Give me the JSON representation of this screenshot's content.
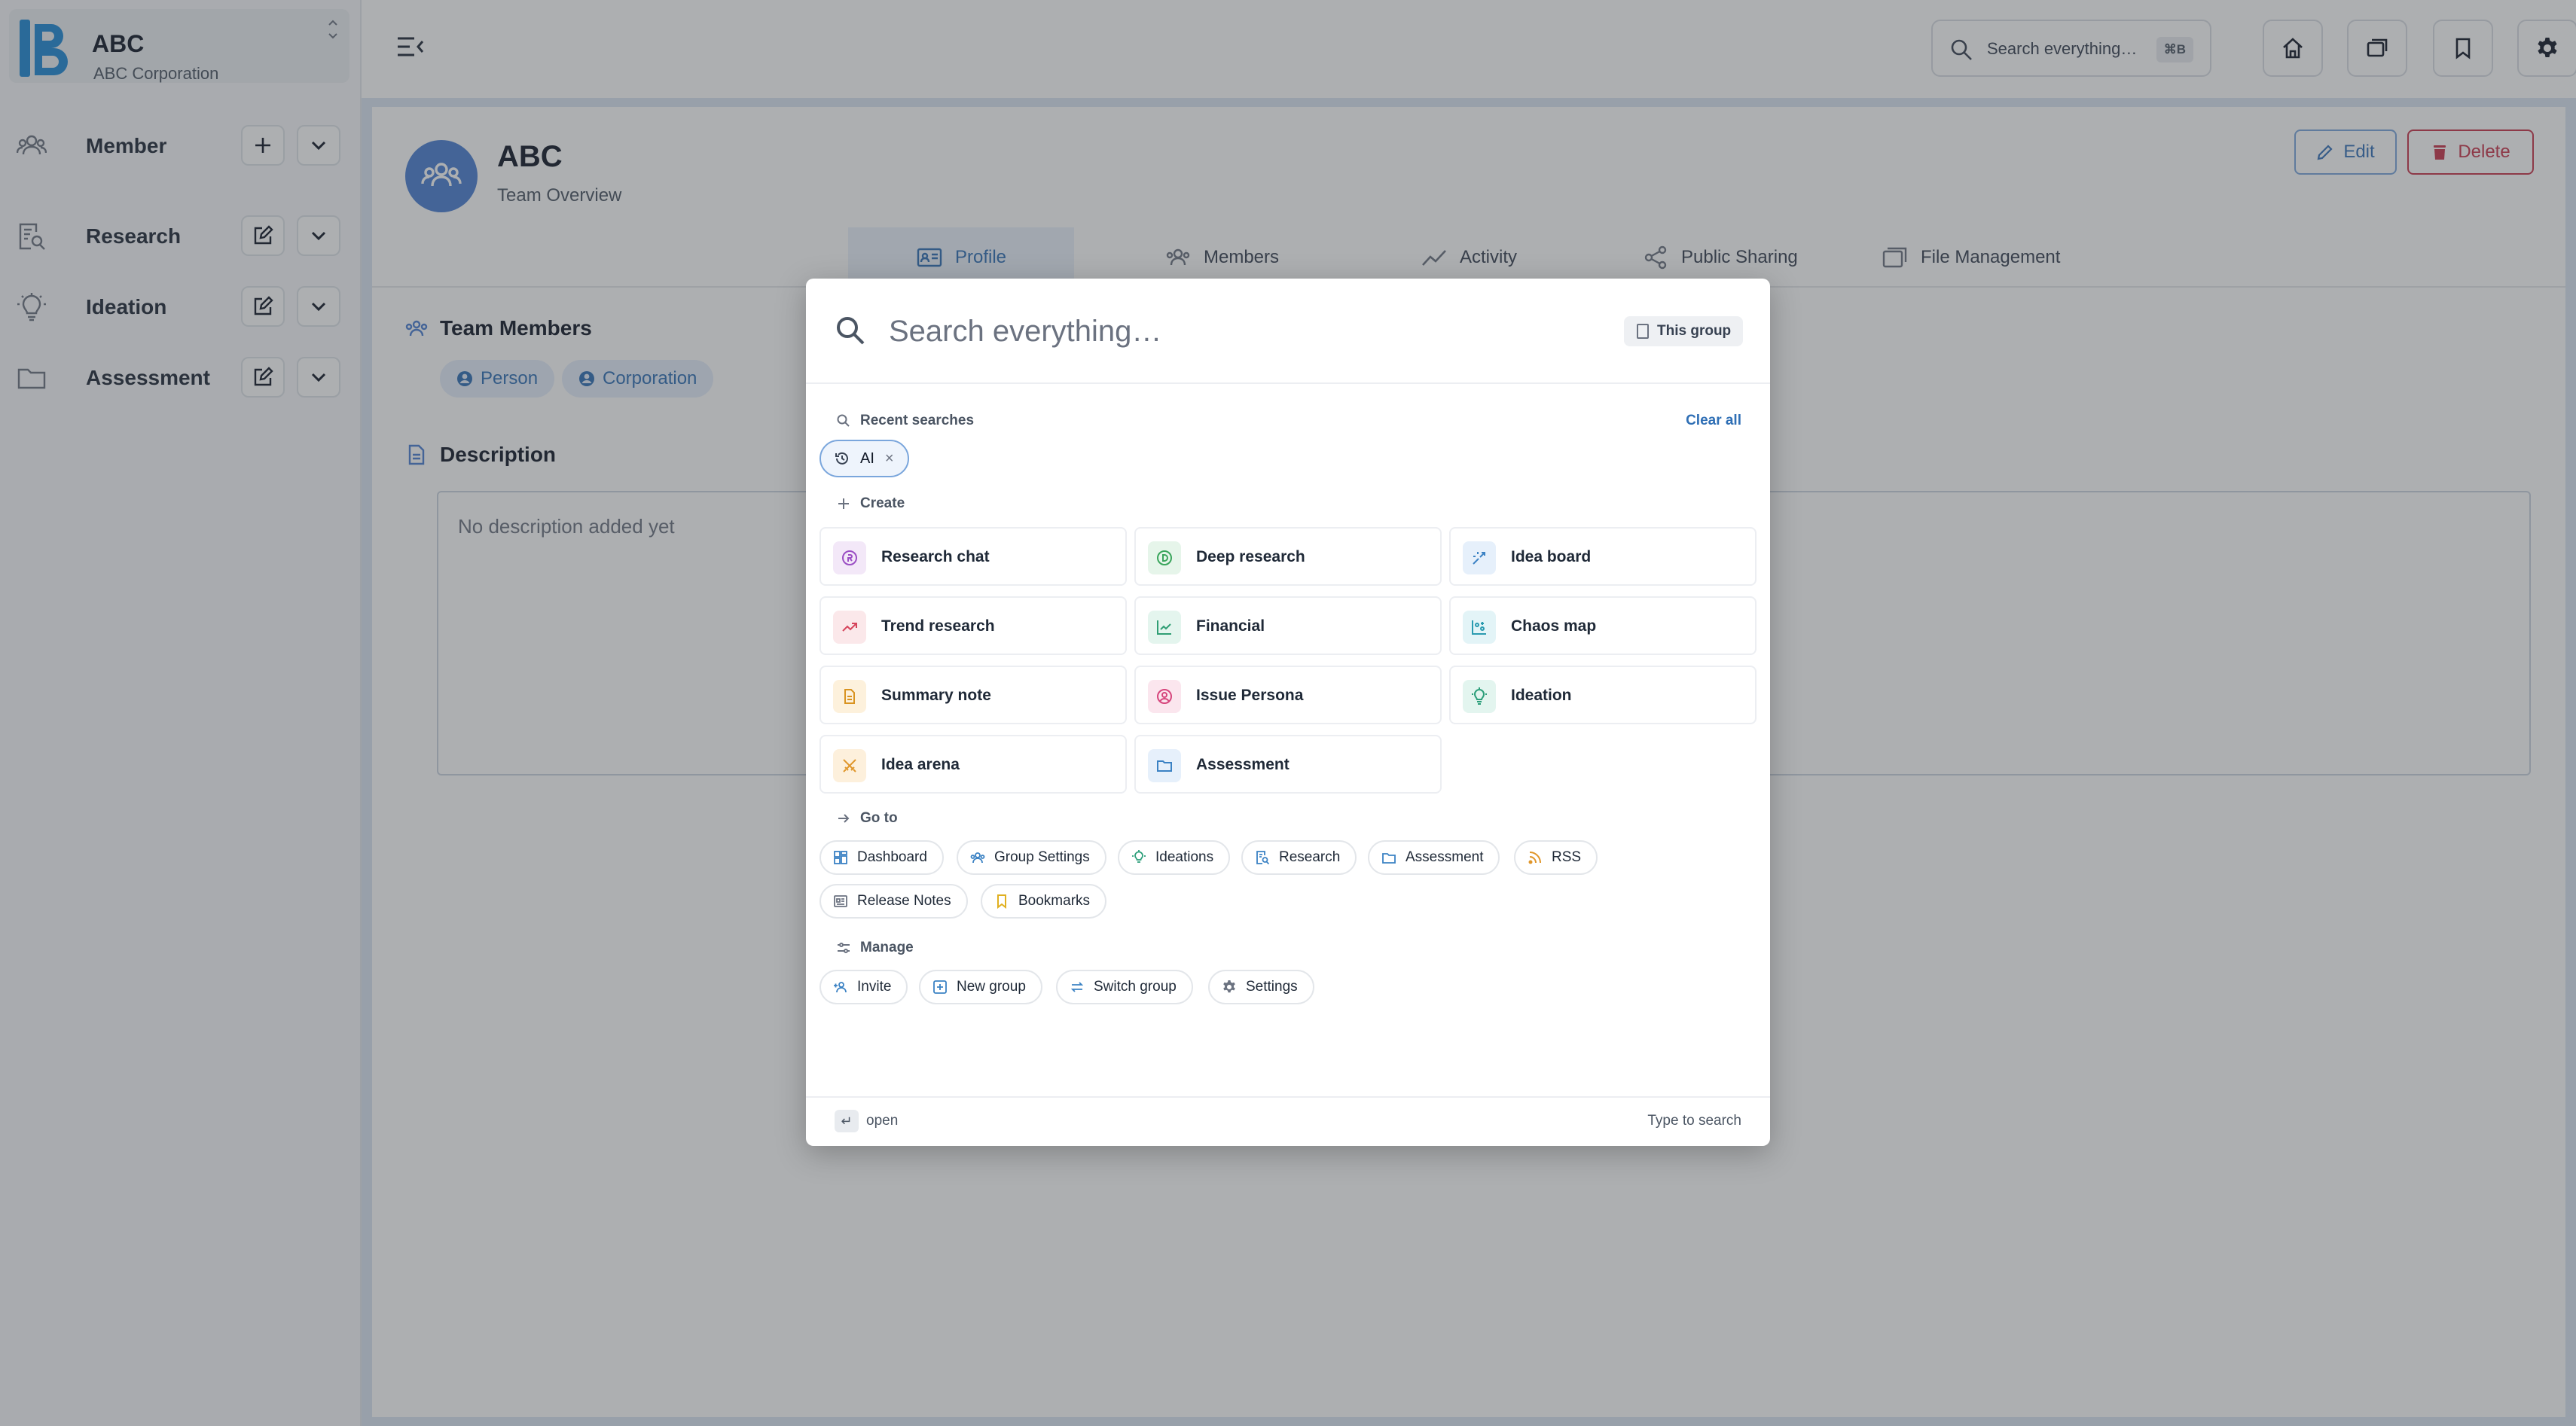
{
  "org": {
    "name": "ABC",
    "subtitle": "ABC Corporation",
    "logo_letter": "B"
  },
  "sidebar": {
    "items": [
      {
        "label": "Member",
        "icon": "people-icon",
        "action": "add"
      },
      {
        "label": "Research",
        "icon": "research-doc-icon",
        "action": "edit"
      },
      {
        "label": "Ideation",
        "icon": "lightbulb-icon",
        "action": "edit"
      },
      {
        "label": "Assessment",
        "icon": "folder-icon",
        "action": "edit"
      }
    ]
  },
  "topbar": {
    "search_placeholder": "Search everything…",
    "search_shortcut": "⌘B",
    "buttons": [
      "home-icon",
      "windows-icon",
      "bookmark-icon",
      "gear-icon"
    ]
  },
  "team": {
    "title": "ABC",
    "subtitle": "Team Overview",
    "edit_label": "Edit",
    "delete_label": "Delete"
  },
  "tabs": [
    {
      "label": "Profile",
      "active": true
    },
    {
      "label": "Members",
      "active": false
    },
    {
      "label": "Activity",
      "active": false
    },
    {
      "label": "Public Sharing",
      "active": false
    },
    {
      "label": "File Management",
      "active": false
    }
  ],
  "members_section": {
    "title": "Team Members",
    "chips": [
      "Person",
      "Corporation"
    ]
  },
  "description_section": {
    "title": "Description",
    "placeholder": "No description added yet"
  },
  "palette": {
    "search_placeholder": "Search everything…",
    "scope_label": "This group",
    "recent": {
      "label": "Recent searches",
      "clear_label": "Clear all",
      "items": [
        "AI"
      ]
    },
    "create": {
      "label": "Create",
      "items": [
        {
          "label": "Research chat",
          "icon": "research-chat-icon",
          "bg": "#f3e8f8",
          "fg": "#9b4fc4"
        },
        {
          "label": "Deep research",
          "icon": "deep-research-icon",
          "bg": "#e6f5ea",
          "fg": "#3aa55c"
        },
        {
          "label": "Idea board",
          "icon": "idea-board-icon",
          "bg": "#e6f0fb",
          "fg": "#3b82c4"
        },
        {
          "label": "Trend research",
          "icon": "trend-icon",
          "bg": "#fbe8ea",
          "fg": "#d6455c"
        },
        {
          "label": "Financial",
          "icon": "financial-chart-icon",
          "bg": "#e4f5ee",
          "fg": "#2f9e74"
        },
        {
          "label": "Chaos map",
          "icon": "chaos-map-icon",
          "bg": "#e3f4f7",
          "fg": "#2a9bb0"
        },
        {
          "label": "Summary note",
          "icon": "summary-note-icon",
          "bg": "#fdf1dc",
          "fg": "#d99320"
        },
        {
          "label": "Issue Persona",
          "icon": "persona-icon",
          "bg": "#fbe6ee",
          "fg": "#d6457c"
        },
        {
          "label": "Ideation",
          "icon": "lightbulb-icon",
          "bg": "#e3f5ef",
          "fg": "#2c9f7a"
        },
        {
          "label": "Idea arena",
          "icon": "swords-icon",
          "bg": "#fdf0dc",
          "fg": "#e0962a"
        },
        {
          "label": "Assessment",
          "icon": "folder-icon",
          "bg": "#e6f0fb",
          "fg": "#3b82c4"
        }
      ]
    },
    "goto": {
      "label": "Go to",
      "items": [
        {
          "label": "Dashboard",
          "icon": "dashboard-icon",
          "color": "#3b82c4"
        },
        {
          "label": "Group Settings",
          "icon": "group-icon",
          "color": "#3b82c4"
        },
        {
          "label": "Ideations",
          "icon": "lightbulb-icon",
          "color": "#2c9f7a"
        },
        {
          "label": "Research",
          "icon": "research-doc-icon",
          "color": "#3b82c4"
        },
        {
          "label": "Assessment",
          "icon": "folder-icon",
          "color": "#3b82c4"
        },
        {
          "label": "RSS",
          "icon": "rss-icon",
          "color": "#e0962a"
        },
        {
          "label": "Release Notes",
          "icon": "release-notes-icon",
          "color": "#6b7280"
        },
        {
          "label": "Bookmarks",
          "icon": "bookmark-icon",
          "color": "#e0b020"
        }
      ]
    },
    "manage": {
      "label": "Manage",
      "items": [
        {
          "label": "Invite",
          "icon": "invite-icon",
          "color": "#3b82c4"
        },
        {
          "label": "New group",
          "icon": "new-group-icon",
          "color": "#3b82c4"
        },
        {
          "label": "Switch group",
          "icon": "switch-icon",
          "color": "#3b82c4"
        },
        {
          "label": "Settings",
          "icon": "gear-icon",
          "color": "#6b7280"
        }
      ]
    },
    "footer": {
      "enter_key": "↵",
      "open_label": "open",
      "hint": "Type to search"
    }
  }
}
